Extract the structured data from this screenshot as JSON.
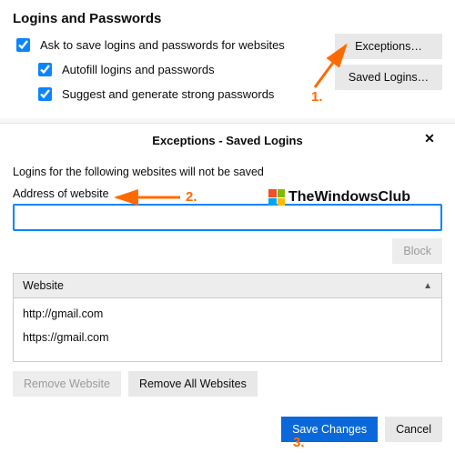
{
  "settings": {
    "heading": "Logins and Passwords",
    "ask_label": "Ask to save logins and passwords for websites",
    "autofill_label": "Autofill logins and passwords",
    "suggest_label": "Suggest and generate strong passwords",
    "exceptions_btn": "Exceptions…",
    "saved_logins_btn": "Saved Logins…"
  },
  "dialog": {
    "title": "Exceptions - Saved Logins",
    "close_glyph": "✕",
    "description": "Logins for the following websites will not be saved",
    "field_label": "Address of website",
    "address_value": "",
    "block_btn": "Block",
    "col_header": "Website",
    "sort_glyph": "▲",
    "rows": [
      "http://gmail.com",
      "https://gmail.com"
    ],
    "remove_one_btn": "Remove Website",
    "remove_all_btn": "Remove All Websites",
    "save_btn": "Save Changes",
    "cancel_btn": "Cancel"
  },
  "annotations": {
    "n1": "1.",
    "n2": "2.",
    "n3": "3.",
    "watermark": "TheWindowsClub"
  },
  "colors": {
    "accent": "#0a84ff",
    "primary_btn": "#0a68da",
    "annotation": "#ff6a00"
  }
}
